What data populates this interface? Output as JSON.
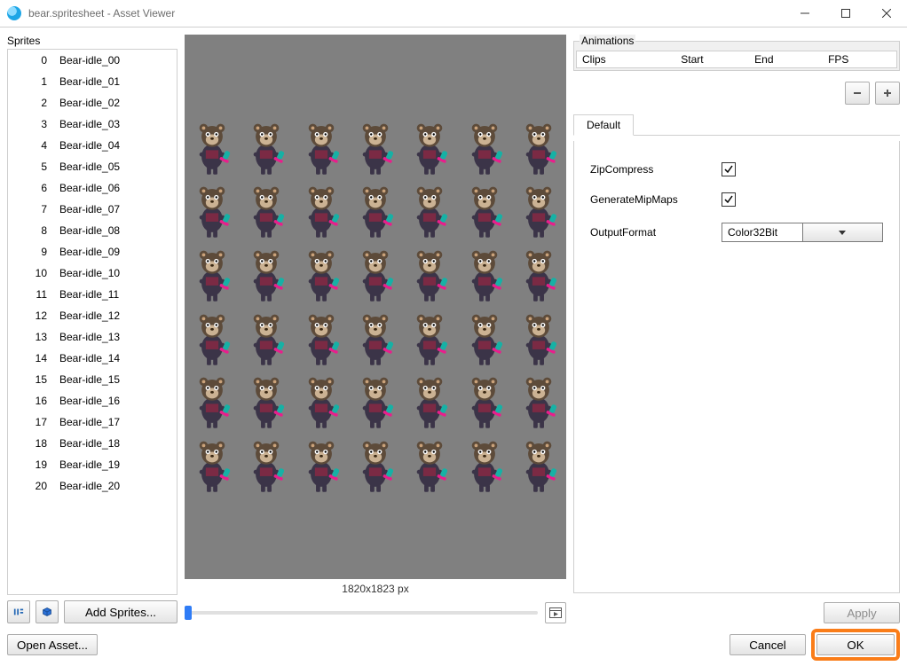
{
  "window": {
    "title": "bear.spritesheet - Asset Viewer"
  },
  "sprites": {
    "label": "Sprites",
    "items": [
      {
        "idx": "0",
        "name": "Bear-idle_00"
      },
      {
        "idx": "1",
        "name": "Bear-idle_01"
      },
      {
        "idx": "2",
        "name": "Bear-idle_02"
      },
      {
        "idx": "3",
        "name": "Bear-idle_03"
      },
      {
        "idx": "4",
        "name": "Bear-idle_04"
      },
      {
        "idx": "5",
        "name": "Bear-idle_05"
      },
      {
        "idx": "6",
        "name": "Bear-idle_06"
      },
      {
        "idx": "7",
        "name": "Bear-idle_07"
      },
      {
        "idx": "8",
        "name": "Bear-idle_08"
      },
      {
        "idx": "9",
        "name": "Bear-idle_09"
      },
      {
        "idx": "10",
        "name": "Bear-idle_10"
      },
      {
        "idx": "11",
        "name": "Bear-idle_11"
      },
      {
        "idx": "12",
        "name": "Bear-idle_12"
      },
      {
        "idx": "13",
        "name": "Bear-idle_13"
      },
      {
        "idx": "14",
        "name": "Bear-idle_14"
      },
      {
        "idx": "15",
        "name": "Bear-idle_15"
      },
      {
        "idx": "16",
        "name": "Bear-idle_16"
      },
      {
        "idx": "17",
        "name": "Bear-idle_17"
      },
      {
        "idx": "18",
        "name": "Bear-idle_18"
      },
      {
        "idx": "19",
        "name": "Bear-idle_19"
      },
      {
        "idx": "20",
        "name": "Bear-idle_20"
      }
    ],
    "add_button": "Add Sprites..."
  },
  "preview": {
    "dimensions": "1820x1823 px",
    "bear_count": 42
  },
  "animations": {
    "legend": "Animations",
    "cols": {
      "clips": "Clips",
      "start": "Start",
      "end": "End",
      "fps": "FPS"
    }
  },
  "settings_tab": {
    "label": "Default",
    "zip_label": "ZipCompress",
    "zip_checked": true,
    "mip_label": "GenerateMipMaps",
    "mip_checked": true,
    "format_label": "OutputFormat",
    "format_value": "Color32Bit"
  },
  "buttons": {
    "apply": "Apply",
    "ok": "OK",
    "cancel": "Cancel",
    "open_asset": "Open Asset..."
  }
}
